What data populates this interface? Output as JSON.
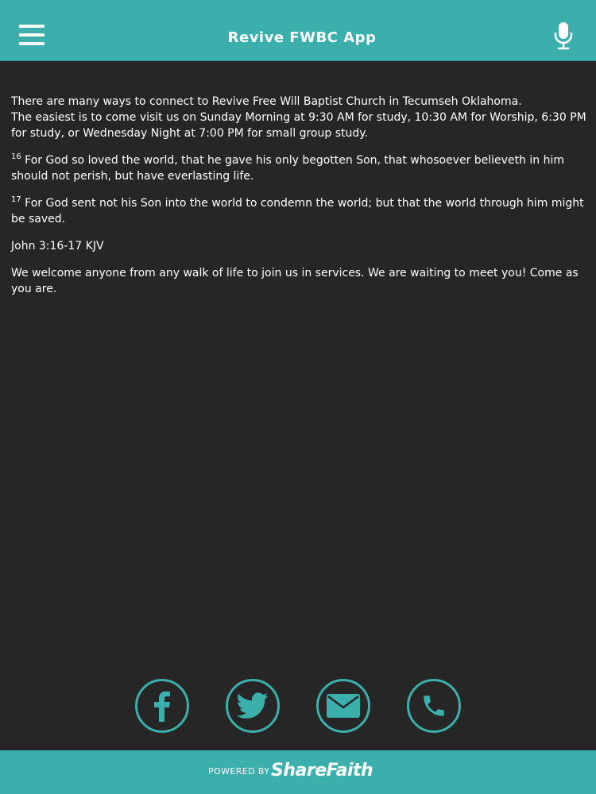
{
  "header": {
    "title": "Revive FWBC App",
    "menu_icon": "hamburger-menu-icon",
    "mic_icon": "microphone-icon"
  },
  "content": {
    "intro_line1": " There are many ways to connect to Revive Free Will Baptist Church in Tecumseh Oklahoma.",
    "intro_line2": "The easiest is to come visit us on Sunday Morning at 9:30 AM for study, 10:30 AM for Worship, 6:30 PM for study, or Wednesday Night at 7:00 PM for small group study.",
    "verse16_num": "16",
    "verse16_text": " For God so loved the world, that he gave his only begotten Son, that whosoever believeth in him should not perish, but have everlasting life.",
    "verse17_num": "17",
    "verse17_text": " For God sent not his Son into the world to condemn the world; but that the world through him might be saved.",
    "reference": "John 3:16-17 KJV",
    "welcome": "We welcome anyone from any  walk of life to join us in services. We are waiting to meet you! Come as you are."
  },
  "social": [
    {
      "icon": "facebook-icon"
    },
    {
      "icon": "twitter-icon"
    },
    {
      "icon": "email-icon"
    },
    {
      "icon": "phone-icon"
    }
  ],
  "footer": {
    "powered_by": "POWERED BY",
    "brand": "ShareFaith"
  },
  "colors": {
    "accent": "#3aafab",
    "background": "#262627",
    "text": "#ffffff"
  }
}
